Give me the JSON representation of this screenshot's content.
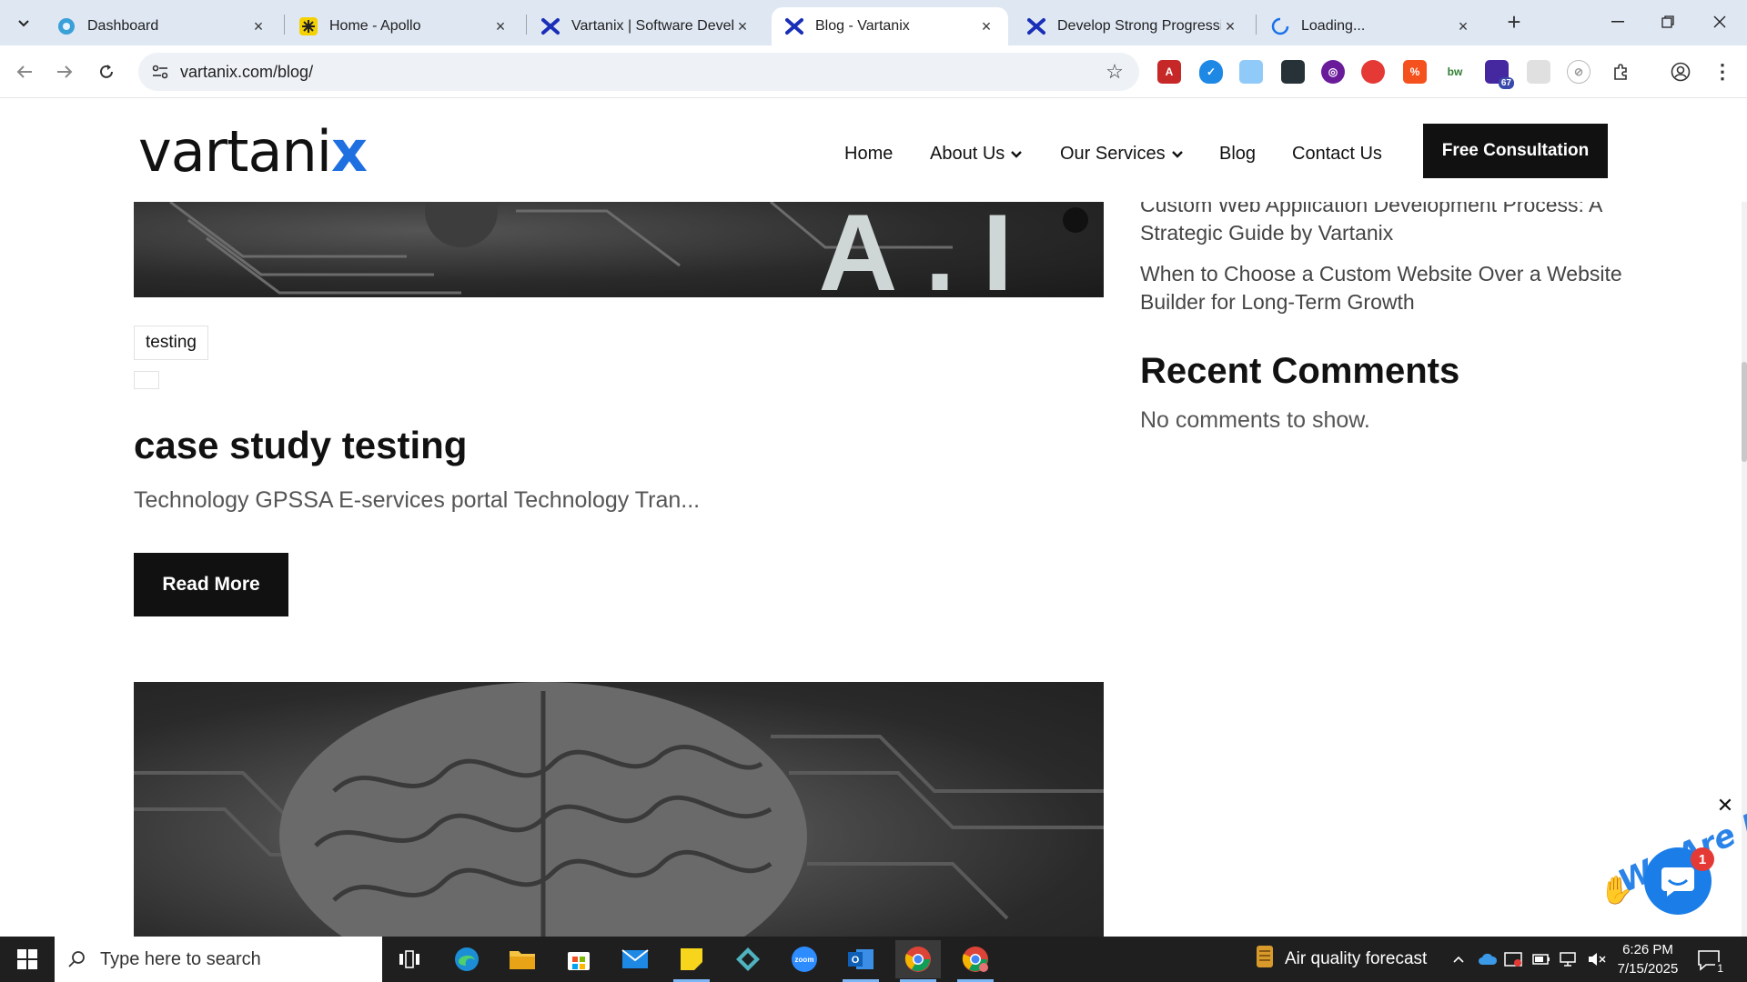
{
  "browser": {
    "tabs": [
      {
        "label": "Dashboard",
        "icon": "dashboard-favicon"
      },
      {
        "label": "Home - Apollo",
        "icon": "apollo-favicon"
      },
      {
        "label": "Vartanix | Software Develop",
        "icon": "vartanix-favicon"
      },
      {
        "label": "Blog - Vartanix",
        "icon": "vartanix-favicon",
        "active": true
      },
      {
        "label": "Develop Strong Progressive",
        "icon": "vartanix-favicon"
      },
      {
        "label": "Loading...",
        "icon": "loading-spinner"
      }
    ],
    "url": "vartanix.com/blog/",
    "extension_badge": "67"
  },
  "site": {
    "logo_main": "vartani",
    "logo_accent": "x",
    "nav": [
      {
        "label": "Home"
      },
      {
        "label": "About Us",
        "dropdown": true
      },
      {
        "label": "Our Services",
        "dropdown": true
      },
      {
        "label": "Blog"
      },
      {
        "label": "Contact Us"
      }
    ],
    "cta_label": "Free Consultation",
    "accent_color": "#1e6fe0"
  },
  "post": {
    "hero_text": "A.I",
    "tag": "testing",
    "title": "case study testing",
    "excerpt": "Technology GPSSA E-services portal Technology Tran...",
    "read_more": "Read More"
  },
  "sidebar": {
    "recent_posts": [
      "Custom Web Application Development Process: A Strategic Guide by Vartanix",
      "When to Choose a Custom Website Over a Website Builder for Long-Term Growth"
    ],
    "comments_heading": "Recent Comments",
    "comments_empty": "No comments to show."
  },
  "chat": {
    "banner": "We Are Here!",
    "badge": "1",
    "color": "#1a7de8"
  },
  "taskbar": {
    "search_placeholder": "Type here to search",
    "weather": "Air quality forecast",
    "time": "6:26 PM",
    "date": "7/15/2025",
    "notification_count": "1"
  }
}
